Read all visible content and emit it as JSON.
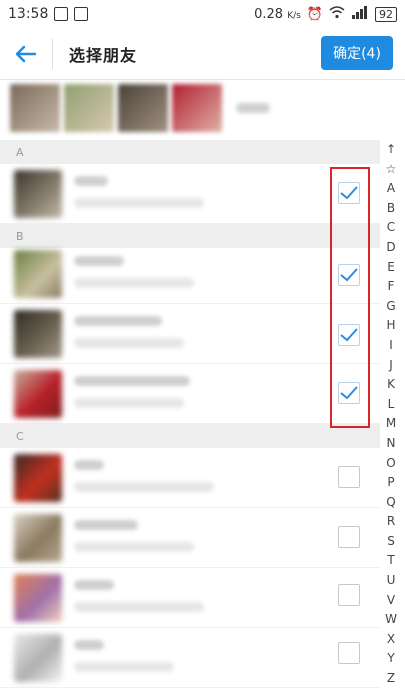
{
  "status": {
    "time": "13:58",
    "speed": "0.28",
    "speed_unit": "K/s",
    "battery": "92"
  },
  "header": {
    "title": "选择朋友",
    "confirm_label": "确定(4)"
  },
  "sections": {
    "a": "A",
    "b": "B",
    "c": "C"
  },
  "alphabet": [
    "↑",
    "☆",
    "A",
    "B",
    "C",
    "D",
    "E",
    "F",
    "G",
    "H",
    "I",
    "J",
    "K",
    "L",
    "M",
    "N",
    "O",
    "P",
    "Q",
    "R",
    "S",
    "T",
    "U",
    "V",
    "W",
    "X",
    "Y",
    "Z"
  ],
  "colors": {
    "accent": "#1e8ae0",
    "highlight_box": "#d9242a"
  }
}
